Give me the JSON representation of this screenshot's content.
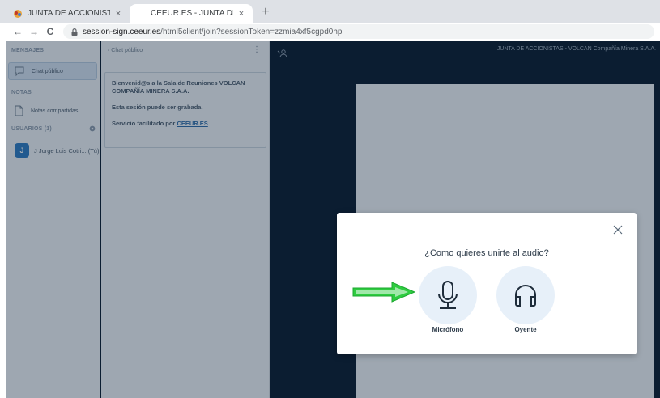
{
  "browser": {
    "tabs": [
      {
        "title": "JUNTA DE ACCIONISTAS - VOLCA",
        "active": false
      },
      {
        "title": "CEEUR.ES - JUNTA DE ACCIONIST",
        "active": true
      }
    ],
    "new_tab_symbol": "+",
    "url_host": "session-sign.ceeur.es",
    "url_path": "/html5client/join?sessionToken=zzmia4xf5cgpd0hp",
    "back_symbol": "←",
    "forward_symbol": "→",
    "reload_symbol": "C"
  },
  "sidebar": {
    "messages_label": "MENSAJES",
    "public_chat": "Chat público",
    "notes_label": "NOTAS",
    "shared_notes": "Notas compartidas",
    "users_label": "USUARIOS (1)",
    "user": {
      "initial": "J",
      "name": "J Jorge Luis Cotri... (Tú)"
    }
  },
  "chat": {
    "header": "‹ Chat público",
    "menu_symbol": "⋮",
    "welcome_line1": "Bienvenid@s a la Sala de Reuniones VOLCAN COMPAÑÍA MINERA S.A.A.",
    "welcome_line2": "Esta sesión puede ser grabada.",
    "welcome_line3_prefix": "Servicio facilitado por ",
    "welcome_link": "CEEUR.ES"
  },
  "meeting": {
    "title": "JUNTA DE ACCIONISTAS - VOLCAN Compañía Minera S.A.A."
  },
  "audio_modal": {
    "title": "¿Como quieres unirte al audio?",
    "microphone_label": "Micrófono",
    "listen_label": "Oyente"
  },
  "colors": {
    "app_background": "#06172a",
    "panel": "#f3f6f9",
    "choice_bg": "#e7f0f9",
    "arrow": "#2ecc40",
    "avatar": "#2b79c2"
  },
  "icons": {
    "mic": "microphone-icon",
    "listen": "headphones-icon",
    "close": "close-icon",
    "chat": "chat-bubble-icon",
    "notes": "notes-icon",
    "gear": "gear-icon",
    "users_toggle": "users-icon",
    "arrow": "arrow-right-icon"
  }
}
